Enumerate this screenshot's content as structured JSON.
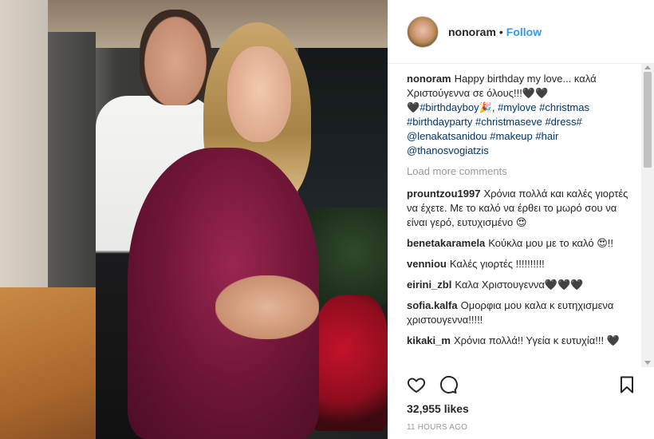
{
  "post": {
    "username": "nonoram",
    "dot": "•",
    "follow_label": "Follow",
    "avatar_icon": "profile-avatar",
    "photo_description_icon": "post-photo"
  },
  "caption": {
    "username": "nonoram",
    "text": "Happy birthday my love... καλά Χριστούγεννα σε όλους!!!🖤🖤",
    "text2": "🖤",
    "tags": [
      "#birthdayboy🎉",
      "#mylove",
      "#christmas",
      "#birthdayparty",
      "#christmaseve",
      "#dress#",
      "@lenakatsanidou",
      "#makeup",
      "#hair",
      "@thanosvogiatzis"
    ]
  },
  "load_more_label": "Load more comments",
  "comments": [
    {
      "username": "prountzou1997",
      "text": "Χρόνια πολλά και καλές γιορτές να έχετε. Με το καλό να έρθει το μωρό σου να είναι γερό, ευτυχισμένο 😍"
    },
    {
      "username": "benetakaramela",
      "text": "Κούκλα μου με το καλό 😍!!"
    },
    {
      "username": "venniou",
      "text": "Καλές γιορτές !!!!!!!!!!"
    },
    {
      "username": "eirini_zbl",
      "text": "Καλα Χριστουγεννα🖤🖤🖤"
    },
    {
      "username": "sofia.kalfa",
      "text": "Ομορφια μου καλα κ ευτηχισμενα χριστουγεννα!!!!!"
    },
    {
      "username": "kikaki_m",
      "text": "Χρόνια πολλά!! Υγεία κ ευτυχία!!! 🖤"
    }
  ],
  "actions": {
    "like_icon": "heart-icon",
    "comment_icon": "speech-bubble-icon",
    "save_icon": "bookmark-icon"
  },
  "likes": "32,955 likes",
  "time": "11 HOURS AGO",
  "colors": {
    "link_blue": "#3897f0",
    "tag_blue": "#003569",
    "text": "#262626",
    "muted": "#999999"
  }
}
